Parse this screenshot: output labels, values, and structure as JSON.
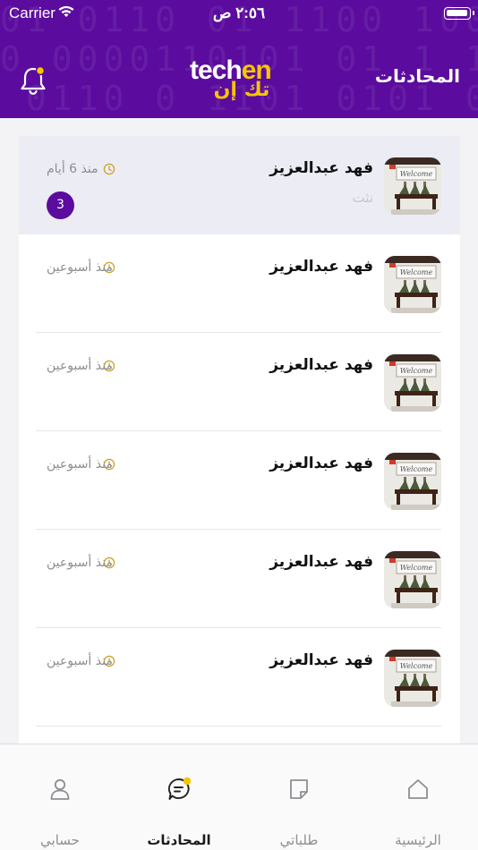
{
  "status_bar": {
    "carrier": "Carrier",
    "time": "٢:٥٦ ص"
  },
  "header": {
    "title": "المحادثات",
    "logo": {
      "latin_prefix": "tech",
      "latin_suffix": "en",
      "arabic": "تك إن"
    },
    "notification_dot": true
  },
  "conversations": [
    {
      "name": "فهد عبدالعزيز",
      "time": "منذ 6 أيام",
      "preview": "نثت",
      "unread": "3",
      "highlighted": true
    },
    {
      "name": "فهد عبدالعزيز",
      "time": "منذ أسبوعين",
      "preview": "",
      "unread": "",
      "highlighted": false
    },
    {
      "name": "فهد عبدالعزيز",
      "time": "منذ أسبوعين",
      "preview": "",
      "unread": "",
      "highlighted": false
    },
    {
      "name": "فهد عبدالعزيز",
      "time": "منذ أسبوعين",
      "preview": "",
      "unread": "",
      "highlighted": false
    },
    {
      "name": "فهد عبدالعزيز",
      "time": "منذ أسبوعين",
      "preview": "",
      "unread": "",
      "highlighted": false
    },
    {
      "name": "فهد عبدالعزيز",
      "time": "منذ أسبوعين",
      "preview": "",
      "unread": "",
      "highlighted": false
    }
  ],
  "tabbar": {
    "home": "الرئيسية",
    "orders": "طلباتي",
    "chats": "المحادثات",
    "account": "حسابي",
    "active": "chats"
  },
  "colors": {
    "brand": "#5b0c9e",
    "accent": "#f7c500",
    "highlight_row": "#ececf4"
  },
  "icons": [
    "bell-icon",
    "clock-icon",
    "home-icon",
    "orders-icon",
    "chat-icon",
    "user-icon"
  ]
}
